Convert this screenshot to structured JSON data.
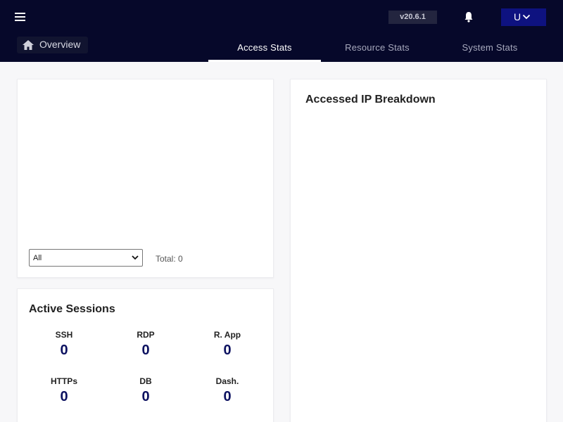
{
  "header": {
    "version": "v20.6.1",
    "user_initial": "U",
    "overview_label": "Overview"
  },
  "tabs": [
    {
      "label": "Access Stats",
      "active": true
    },
    {
      "label": "Resource Stats",
      "active": false
    },
    {
      "label": "System Stats",
      "active": false
    }
  ],
  "access_chart_card": {
    "filter_value": "All",
    "total_label": "Total: 0"
  },
  "sessions": {
    "title": "Active Sessions",
    "items": [
      {
        "label": "SSH",
        "value": "0"
      },
      {
        "label": "RDP",
        "value": "0"
      },
      {
        "label": "R. App",
        "value": "0"
      },
      {
        "label": "HTTPs",
        "value": "0"
      },
      {
        "label": "DB",
        "value": "0"
      },
      {
        "label": "Dash.",
        "value": "0"
      }
    ]
  },
  "ip_breakdown": {
    "title": "Accessed IP Breakdown"
  },
  "icons": {
    "menu": "menu-icon",
    "bell": "bell-icon",
    "chevron": "chevron-down-icon",
    "home": "home-icon"
  },
  "colors": {
    "header_bg": "#06082a",
    "accent": "#0e1280",
    "stat_value": "#0c1160"
  }
}
